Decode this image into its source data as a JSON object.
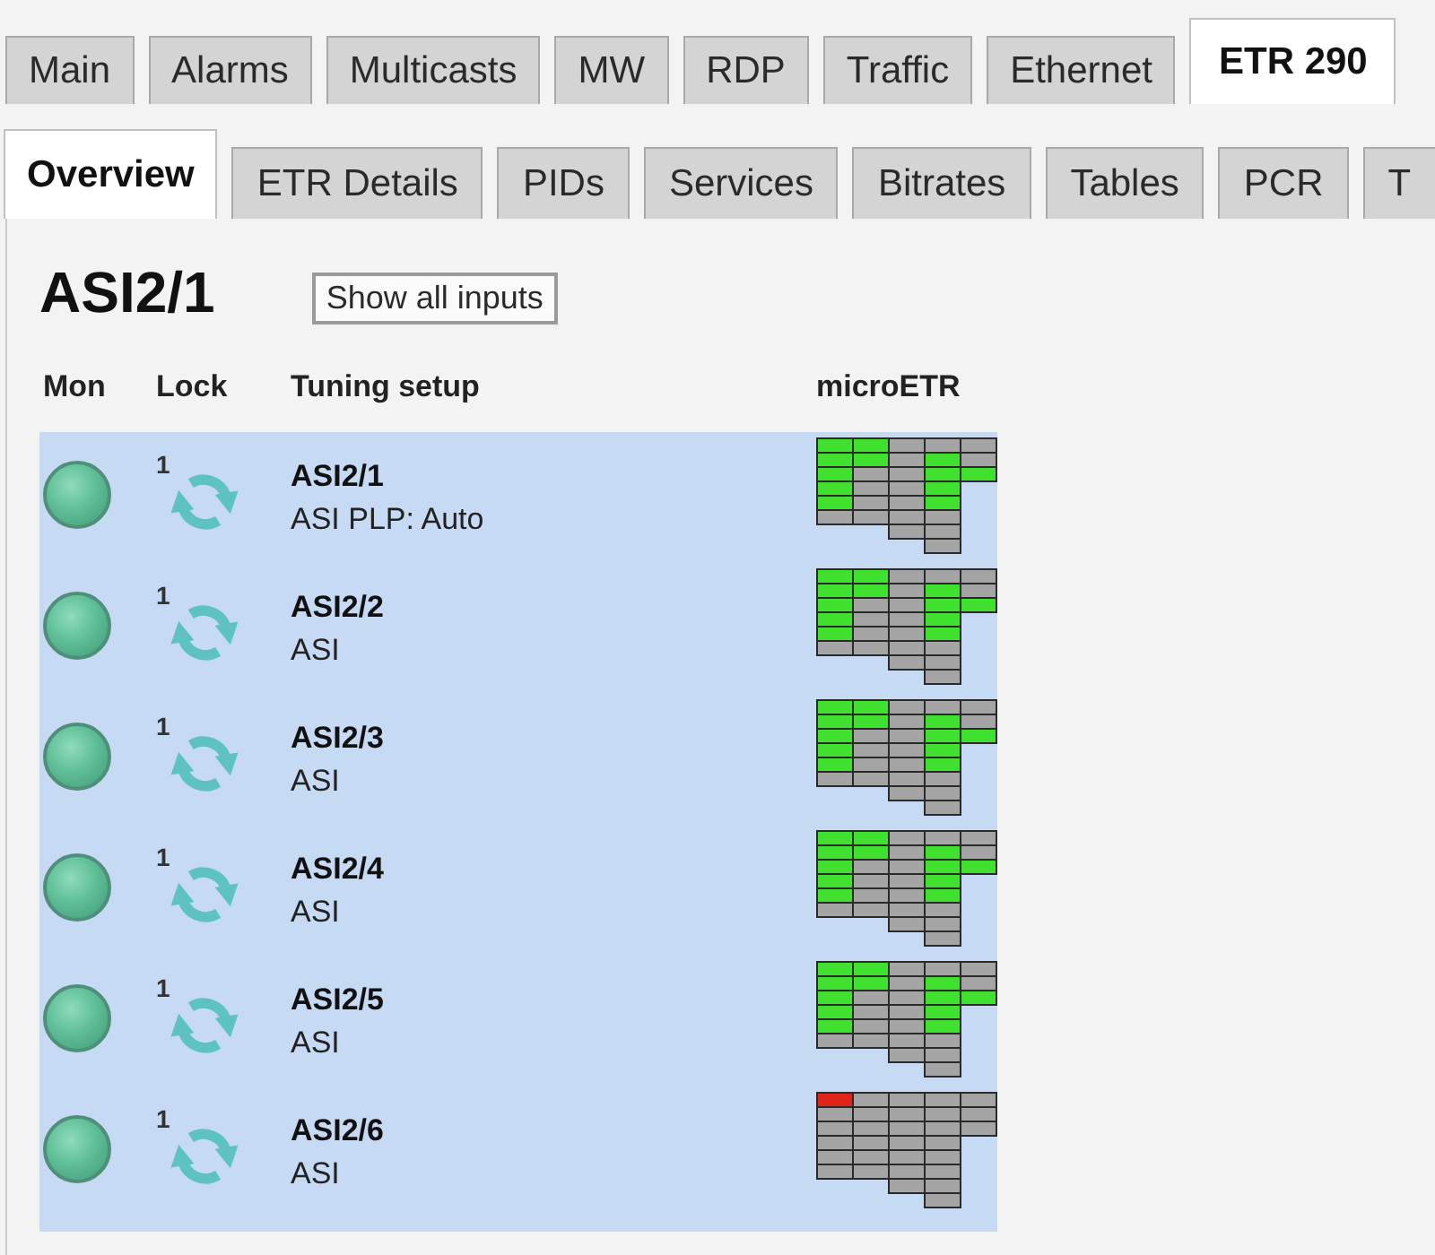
{
  "tabs": [
    {
      "label": "Main",
      "selected": false
    },
    {
      "label": "Alarms",
      "selected": false
    },
    {
      "label": "Multicasts",
      "selected": false
    },
    {
      "label": "MW",
      "selected": false
    },
    {
      "label": "RDP",
      "selected": false
    },
    {
      "label": "Traffic",
      "selected": false
    },
    {
      "label": "Ethernet",
      "selected": false
    },
    {
      "label": "ETR 290",
      "selected": true
    }
  ],
  "subtabs": [
    {
      "label": "Overview",
      "selected": true
    },
    {
      "label": "ETR Details",
      "selected": false
    },
    {
      "label": "PIDs",
      "selected": false
    },
    {
      "label": "Services",
      "selected": false
    },
    {
      "label": "Bitrates",
      "selected": false
    },
    {
      "label": "Tables",
      "selected": false
    },
    {
      "label": "PCR",
      "selected": false
    },
    {
      "label": "T",
      "selected": false
    }
  ],
  "title": "ASI2/1",
  "show_all_button": "Show all inputs",
  "columns": [
    "Mon",
    "Lock",
    "Tuning setup",
    "microETR"
  ],
  "rows": [
    {
      "name": "ASI2/1",
      "setup": "ASI PLP: Auto",
      "monitored": true,
      "lock_input": "1",
      "locked": true,
      "etr": [
        [
          {
            "color": "#3fe02e"
          },
          {
            "color": "#3fe02e"
          },
          {
            "color": "#3fe02e"
          },
          {
            "color": "#3fe02e"
          },
          {
            "color": "#3fe02e"
          },
          {
            "color": "#a4a4a4"
          }
        ],
        [
          {
            "color": "#3fe02e"
          },
          {
            "color": "#3fe02e"
          },
          {
            "color": "#a4a4a4"
          },
          {
            "color": "#a4a4a4"
          },
          {
            "color": "#a4a4a4"
          },
          {
            "color": "#a4a4a4"
          }
        ],
        [
          {
            "color": "#a4a4a4"
          },
          {
            "color": "#a4a4a4"
          },
          {
            "color": "#a4a4a4"
          },
          {
            "color": "#a4a4a4"
          },
          {
            "color": "#a4a4a4"
          },
          {
            "color": "#a4a4a4"
          },
          {
            "color": "#a4a4a4"
          }
        ],
        [
          {
            "color": "#a4a4a4"
          },
          {
            "color": "#3fe02e"
          },
          {
            "color": "#3fe02e"
          },
          {
            "color": "#3fe02e"
          },
          {
            "color": "#3fe02e"
          },
          {
            "color": "#a4a4a4"
          },
          {
            "color": "#a4a4a4"
          },
          {
            "color": "#a4a4a4"
          }
        ],
        [
          {
            "color": "#a4a4a4"
          },
          {
            "color": "#a4a4a4"
          },
          {
            "color": "#3fe02e"
          }
        ]
      ]
    },
    {
      "name": "ASI2/2",
      "setup": "ASI",
      "monitored": true,
      "lock_input": "1",
      "locked": true,
      "etr": [
        [
          {
            "color": "#3fe02e"
          },
          {
            "color": "#3fe02e"
          },
          {
            "color": "#3fe02e"
          },
          {
            "color": "#3fe02e"
          },
          {
            "color": "#3fe02e"
          },
          {
            "color": "#a4a4a4"
          }
        ],
        [
          {
            "color": "#3fe02e"
          },
          {
            "color": "#3fe02e"
          },
          {
            "color": "#a4a4a4"
          },
          {
            "color": "#a4a4a4"
          },
          {
            "color": "#a4a4a4"
          },
          {
            "color": "#a4a4a4"
          }
        ],
        [
          {
            "color": "#a4a4a4"
          },
          {
            "color": "#a4a4a4"
          },
          {
            "color": "#a4a4a4"
          },
          {
            "color": "#a4a4a4"
          },
          {
            "color": "#a4a4a4"
          },
          {
            "color": "#a4a4a4"
          },
          {
            "color": "#a4a4a4"
          }
        ],
        [
          {
            "color": "#a4a4a4"
          },
          {
            "color": "#3fe02e"
          },
          {
            "color": "#3fe02e"
          },
          {
            "color": "#3fe02e"
          },
          {
            "color": "#3fe02e"
          },
          {
            "color": "#a4a4a4"
          },
          {
            "color": "#a4a4a4"
          },
          {
            "color": "#a4a4a4"
          }
        ],
        [
          {
            "color": "#a4a4a4"
          },
          {
            "color": "#a4a4a4"
          },
          {
            "color": "#3fe02e"
          }
        ]
      ]
    },
    {
      "name": "ASI2/3",
      "setup": "ASI",
      "monitored": true,
      "lock_input": "1",
      "locked": true,
      "etr": [
        [
          {
            "color": "#3fe02e"
          },
          {
            "color": "#3fe02e"
          },
          {
            "color": "#3fe02e"
          },
          {
            "color": "#3fe02e"
          },
          {
            "color": "#3fe02e"
          },
          {
            "color": "#a4a4a4"
          }
        ],
        [
          {
            "color": "#3fe02e"
          },
          {
            "color": "#3fe02e"
          },
          {
            "color": "#a4a4a4"
          },
          {
            "color": "#a4a4a4"
          },
          {
            "color": "#a4a4a4"
          },
          {
            "color": "#a4a4a4"
          }
        ],
        [
          {
            "color": "#a4a4a4"
          },
          {
            "color": "#a4a4a4"
          },
          {
            "color": "#a4a4a4"
          },
          {
            "color": "#a4a4a4"
          },
          {
            "color": "#a4a4a4"
          },
          {
            "color": "#a4a4a4"
          },
          {
            "color": "#a4a4a4"
          }
        ],
        [
          {
            "color": "#a4a4a4"
          },
          {
            "color": "#3fe02e"
          },
          {
            "color": "#3fe02e"
          },
          {
            "color": "#3fe02e"
          },
          {
            "color": "#3fe02e"
          },
          {
            "color": "#a4a4a4"
          },
          {
            "color": "#a4a4a4"
          },
          {
            "color": "#a4a4a4"
          }
        ],
        [
          {
            "color": "#a4a4a4"
          },
          {
            "color": "#a4a4a4"
          },
          {
            "color": "#3fe02e"
          }
        ]
      ]
    },
    {
      "name": "ASI2/4",
      "setup": "ASI",
      "monitored": true,
      "lock_input": "1",
      "locked": true,
      "etr": [
        [
          {
            "color": "#3fe02e"
          },
          {
            "color": "#3fe02e"
          },
          {
            "color": "#3fe02e"
          },
          {
            "color": "#3fe02e"
          },
          {
            "color": "#3fe02e"
          },
          {
            "color": "#a4a4a4"
          }
        ],
        [
          {
            "color": "#3fe02e"
          },
          {
            "color": "#3fe02e"
          },
          {
            "color": "#a4a4a4"
          },
          {
            "color": "#a4a4a4"
          },
          {
            "color": "#a4a4a4"
          },
          {
            "color": "#a4a4a4"
          }
        ],
        [
          {
            "color": "#a4a4a4"
          },
          {
            "color": "#a4a4a4"
          },
          {
            "color": "#a4a4a4"
          },
          {
            "color": "#a4a4a4"
          },
          {
            "color": "#a4a4a4"
          },
          {
            "color": "#a4a4a4"
          },
          {
            "color": "#a4a4a4"
          }
        ],
        [
          {
            "color": "#a4a4a4"
          },
          {
            "color": "#3fe02e"
          },
          {
            "color": "#3fe02e"
          },
          {
            "color": "#3fe02e"
          },
          {
            "color": "#3fe02e"
          },
          {
            "color": "#a4a4a4"
          },
          {
            "color": "#a4a4a4"
          },
          {
            "color": "#a4a4a4"
          }
        ],
        [
          {
            "color": "#a4a4a4"
          },
          {
            "color": "#a4a4a4"
          },
          {
            "color": "#3fe02e"
          }
        ]
      ]
    },
    {
      "name": "ASI2/5",
      "setup": "ASI",
      "monitored": true,
      "lock_input": "1",
      "locked": true,
      "etr": [
        [
          {
            "color": "#3fe02e"
          },
          {
            "color": "#3fe02e"
          },
          {
            "color": "#3fe02e"
          },
          {
            "color": "#3fe02e"
          },
          {
            "color": "#3fe02e"
          },
          {
            "color": "#a4a4a4"
          }
        ],
        [
          {
            "color": "#3fe02e"
          },
          {
            "color": "#3fe02e"
          },
          {
            "color": "#a4a4a4"
          },
          {
            "color": "#a4a4a4"
          },
          {
            "color": "#a4a4a4"
          },
          {
            "color": "#a4a4a4"
          }
        ],
        [
          {
            "color": "#a4a4a4"
          },
          {
            "color": "#a4a4a4"
          },
          {
            "color": "#a4a4a4"
          },
          {
            "color": "#a4a4a4"
          },
          {
            "color": "#a4a4a4"
          },
          {
            "color": "#a4a4a4"
          },
          {
            "color": "#a4a4a4"
          }
        ],
        [
          {
            "color": "#a4a4a4"
          },
          {
            "color": "#3fe02e"
          },
          {
            "color": "#3fe02e"
          },
          {
            "color": "#3fe02e"
          },
          {
            "color": "#3fe02e"
          },
          {
            "color": "#a4a4a4"
          },
          {
            "color": "#a4a4a4"
          },
          {
            "color": "#a4a4a4"
          }
        ],
        [
          {
            "color": "#a4a4a4"
          },
          {
            "color": "#a4a4a4"
          },
          {
            "color": "#3fe02e"
          }
        ]
      ]
    },
    {
      "name": "ASI2/6",
      "setup": "ASI",
      "monitored": true,
      "lock_input": "1",
      "locked": true,
      "etr": [
        [
          {
            "color": "#e0241c"
          },
          {
            "color": "#a4a4a4"
          },
          {
            "color": "#a4a4a4"
          },
          {
            "color": "#a4a4a4"
          },
          {
            "color": "#a4a4a4"
          },
          {
            "color": "#a4a4a4"
          }
        ],
        [
          {
            "color": "#a4a4a4"
          },
          {
            "color": "#a4a4a4"
          },
          {
            "color": "#a4a4a4"
          },
          {
            "color": "#a4a4a4"
          },
          {
            "color": "#a4a4a4"
          },
          {
            "color": "#a4a4a4"
          }
        ],
        [
          {
            "color": "#a4a4a4"
          },
          {
            "color": "#a4a4a4"
          },
          {
            "color": "#a4a4a4"
          },
          {
            "color": "#a4a4a4"
          },
          {
            "color": "#a4a4a4"
          },
          {
            "color": "#a4a4a4"
          },
          {
            "color": "#a4a4a4"
          }
        ],
        [
          {
            "color": "#a4a4a4"
          },
          {
            "color": "#a4a4a4"
          },
          {
            "color": "#a4a4a4"
          },
          {
            "color": "#a4a4a4"
          },
          {
            "color": "#a4a4a4"
          },
          {
            "color": "#a4a4a4"
          },
          {
            "color": "#a4a4a4"
          },
          {
            "color": "#a4a4a4"
          }
        ],
        [
          {
            "color": "#a4a4a4"
          },
          {
            "color": "#a4a4a4"
          },
          {
            "color": "#a4a4a4"
          }
        ]
      ]
    }
  ]
}
